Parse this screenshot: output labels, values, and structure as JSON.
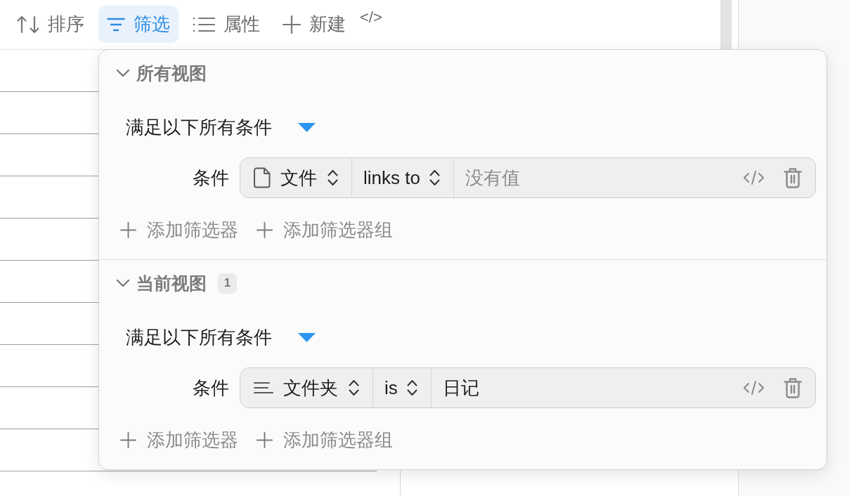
{
  "toolbar": {
    "buttons": [
      {
        "kind": "sort",
        "label": "排序",
        "selected": false
      },
      {
        "kind": "filter",
        "label": "筛选",
        "selected": true
      },
      {
        "kind": "properties",
        "label": "属性",
        "selected": false
      },
      {
        "kind": "new",
        "label": "新建",
        "selected": false
      }
    ],
    "code_toggle": "</>"
  },
  "filter_popup": {
    "sections": [
      {
        "title": "所有视图",
        "expanded": true,
        "match_mode": "满足以下所有条件",
        "conditions": [
          {
            "label": "条件",
            "property": {
              "kind": "file",
              "name": "文件"
            },
            "operator": "links to",
            "value": {
              "placeholder": "没有值"
            }
          }
        ],
        "add_filter": "添加筛选器",
        "add_group": "添加筛选器组"
      },
      {
        "title": "当前视图",
        "count": "1",
        "expanded": true,
        "match_mode": "满足以下所有条件",
        "conditions": [
          {
            "label": "条件",
            "property": {
              "kind": "text",
              "name": "文件夹"
            },
            "operator": "is",
            "value": {
              "text": "日记"
            }
          }
        ],
        "add_filter": "添加筛选器",
        "add_group": "添加筛选器组"
      }
    ]
  }
}
